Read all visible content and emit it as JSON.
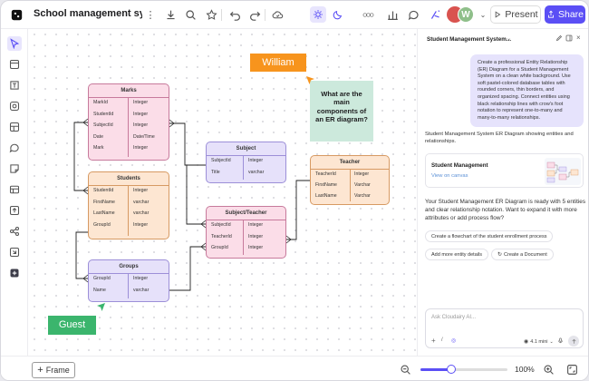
{
  "header": {
    "title": "School management sys...",
    "present_label": "Present",
    "share_label": "Share",
    "avatar_initial": "W",
    "accent": "#5b4ff5"
  },
  "diagram": {
    "entities": {
      "marks": {
        "name": "Marks",
        "rows": [
          {
            "field": "MarkId",
            "type": "Integer"
          },
          {
            "field": "StudentId",
            "type": "Integer"
          },
          {
            "field": "SubjectId",
            "type": "Integer"
          },
          {
            "field": "Date",
            "type": "Date/Time"
          },
          {
            "field": "Mark",
            "type": "Integer"
          }
        ],
        "color": "#fbdde8"
      },
      "students": {
        "name": "Students",
        "rows": [
          {
            "field": "StudentId",
            "type": "Integer"
          },
          {
            "field": "FirstName",
            "type": "varchar"
          },
          {
            "field": "LastName",
            "type": "varchar"
          },
          {
            "field": "GroupId",
            "type": "Integer"
          }
        ],
        "color": "#fde6d2"
      },
      "groups": {
        "name": "Groups",
        "rows": [
          {
            "field": "GroupId",
            "type": "Integer"
          },
          {
            "field": "Name",
            "type": "varchar"
          }
        ],
        "color": "#e6e1fa"
      },
      "subject": {
        "name": "Subject",
        "rows": [
          {
            "field": "SubjectId",
            "type": "Integer"
          },
          {
            "field": "Title",
            "type": "varchar"
          }
        ],
        "color": "#e6e1fa"
      },
      "subject_teacher": {
        "name": "Subject/Teacher",
        "rows": [
          {
            "field": "SubjectId",
            "type": "Integer"
          },
          {
            "field": "TeacherId",
            "type": "Integer"
          },
          {
            "field": "GroupId",
            "type": "Integer"
          }
        ],
        "color": "#fbdde8"
      },
      "teacher": {
        "name": "Teacher",
        "rows": [
          {
            "field": "TeacherId",
            "type": "Integer"
          },
          {
            "field": "FirstName",
            "type": "Varchar"
          },
          {
            "field": "LastName",
            "type": "Varchar"
          }
        ],
        "color": "#fde6d2"
      }
    },
    "sticky_question": "What are the main components of an ER diagram?",
    "cursor_william": "William",
    "cursor_guest": "Guest"
  },
  "bottombar": {
    "frame_label": "Frame",
    "zoom_label": "100%",
    "zoom_level": 0.35
  },
  "panel": {
    "title": "Student Management System...",
    "user_prompt": "Create a professional Entity Relationship (ER) Diagram for a Student Management System on a clean white background. Use soft pastel-colored database tables with rounded corners, thin borders, and organized spacing. Connect entities using black relationship lines with crow's foot notation to represent one-to-many and many-to-many relationships.",
    "reply_intro": "Student Management System ER Diagram showing entities and relationships.",
    "card_title": "Student Management",
    "card_link": "View on canvas",
    "reply_summary": "Your Student Management ER Diagram is ready with 5 entities and clear relationship notation. Want to expand it with more attributes or add process flow?",
    "suggestions": [
      "Create a flowchart of the student enrollment process",
      "Add more entity details",
      "Create a Document"
    ],
    "input_placeholder": "Ask Cloudairy AI...",
    "model_label": "4.1 mini"
  }
}
